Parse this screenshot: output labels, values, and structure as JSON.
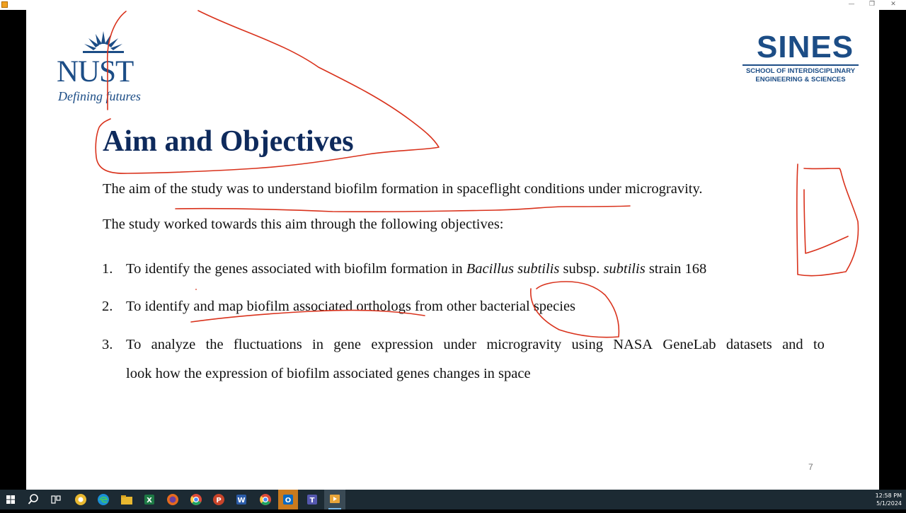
{
  "window": {
    "minimize_glyph": "—",
    "restore_glyph": "❐",
    "close_glyph": "✕"
  },
  "logos": {
    "nust": {
      "word": "NUST",
      "tagline": "Defining futures"
    },
    "sines": {
      "word": "SINES",
      "line1": "SCHOOL OF INTERDISCIPLINARY",
      "line2": "ENGINEERING & SCIENCES"
    }
  },
  "slide": {
    "title": "Aim and Objectives",
    "aim": "The aim of the study was to understand biofilm formation in spaceflight conditions under microgravity.",
    "intro": "The study worked towards this aim through the following objectives:",
    "objectives": [
      {
        "num": "1.",
        "part_a": "To identify the genes associated with biofilm formation in ",
        "italic_a": "Bacillus subtilis",
        "part_b": " subsp. ",
        "italic_b": "subtilis",
        "part_c": " strain 168"
      },
      {
        "num": "2.",
        "text": "To identify and map biofilm associated orthologs from other bacterial species"
      },
      {
        "num": "3.",
        "line1_words": [
          "To",
          "analyze",
          "the",
          "fluctuations",
          "in",
          "gene",
          "expression",
          "under",
          "microgravity",
          "using",
          "NASA",
          "GeneLab",
          "datasets",
          "and",
          "to"
        ],
        "line2": "look how the expression of biofilm associated genes changes in space"
      }
    ],
    "page_number": "7"
  },
  "taskbar": {
    "icons": [
      "windows-start-icon",
      "search-icon",
      "task-view-icon",
      "chrome-canary-icon",
      "edge-icon",
      "file-explorer-icon",
      "excel-icon",
      "firefox-icon",
      "chrome-icon",
      "powerpoint-icon",
      "word-icon",
      "chrome-icon",
      "outlook-icon",
      "teams-icon",
      "presentation-app-icon"
    ],
    "colors": {
      "bar": "#1c2a33",
      "excel": "#1d7a45",
      "powerpoint": "#c8442a",
      "word": "#2b5ca8",
      "edge": "#1a8fd8",
      "explorer": "#e8b830",
      "firefox": "#e66a1f",
      "chrome": "#dd4b39",
      "outlook": "#0b6ac2",
      "teams": "#5558af",
      "active": "#e8a53a"
    },
    "clock_time": "12:58 PM",
    "clock_date": "5/1/2024"
  },
  "annotation_color": "#d9321c"
}
